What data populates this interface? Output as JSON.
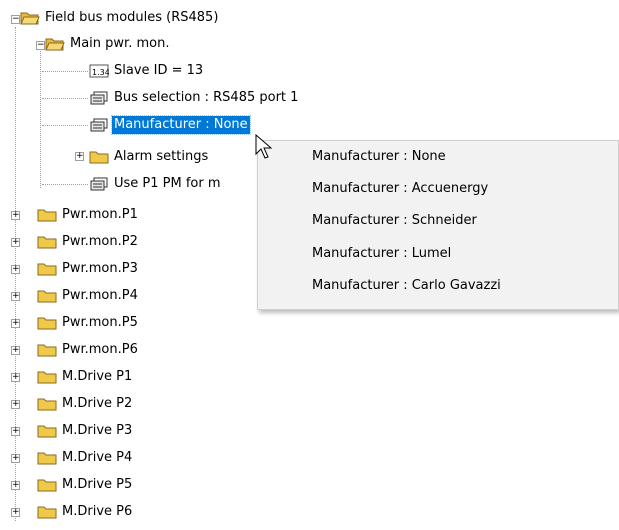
{
  "tree": {
    "root": {
      "label": "Field bus modules (RS485)",
      "icon": "open-folder-icon"
    },
    "main": {
      "label": "Main pwr. mon.",
      "icon": "open-folder-icon"
    },
    "children": [
      {
        "label": "Slave ID = 13",
        "icon": "numeric-value-icon",
        "badge": "1.34"
      },
      {
        "label": "Bus selection : RS485 port 1",
        "icon": "property-icon"
      },
      {
        "label": "Manufacturer : None",
        "icon": "property-icon",
        "selected": true
      },
      {
        "label": "Alarm settings",
        "icon": "folder-icon",
        "expandable": true
      },
      {
        "label": "Use P1 PM for m",
        "icon": "property-icon"
      }
    ],
    "folders": [
      "Pwr.mon.P1",
      "Pwr.mon.P2",
      "Pwr.mon.P3",
      "Pwr.mon.P4",
      "Pwr.mon.P5",
      "Pwr.mon.P6",
      "M.Drive P1",
      "M.Drive P2",
      "M.Drive P3",
      "M.Drive P4",
      "M.Drive P5",
      "M.Drive P6"
    ]
  },
  "context_menu": {
    "items": [
      "Manufacturer : None",
      "Manufacturer : Accuenergy",
      "Manufacturer : Schneider",
      "Manufacturer : Lumel",
      "Manufacturer : Carlo Gavazzi"
    ]
  },
  "colors": {
    "selection": "#0078d7",
    "folder": "#f0c94a",
    "menu_bg": "#f2f2f2"
  },
  "expander_symbols": {
    "expanded": "−",
    "collapsed": "+"
  }
}
